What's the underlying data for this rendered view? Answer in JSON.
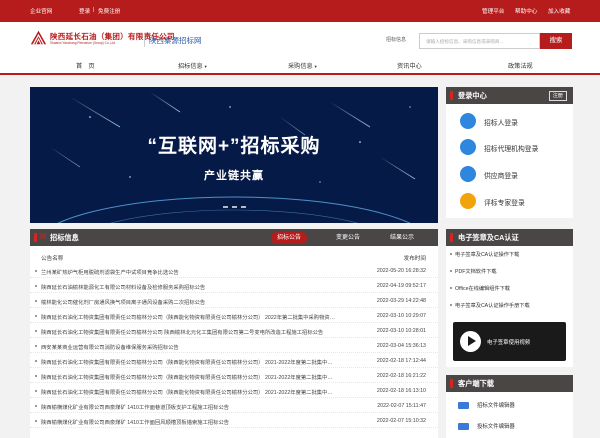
{
  "topbar": {
    "enterprise_site": "企业官网",
    "login": "登录",
    "separator": "|",
    "free_register": "免费注册",
    "admin_platform": "管理平台",
    "help_center": "帮助中心",
    "add_favorite": "加入收藏"
  },
  "header": {
    "company_cn": "陕西延长石油（集团）有限责任公司",
    "company_en": "Shaanxi Yanchang Petroleum (Group) Co.,Ltd.",
    "site_name": "陕西秦源招标网",
    "search_label": "招标信息",
    "search_placeholder": "请输入招标信息、采购信息或采购商...",
    "search_button": "搜索"
  },
  "nav": {
    "items": [
      {
        "label": "首　页",
        "dropdown": false
      },
      {
        "label": "招标信息",
        "dropdown": true
      },
      {
        "label": "采购信息",
        "dropdown": true
      },
      {
        "label": "资讯中心",
        "dropdown": false
      },
      {
        "label": "政策法规",
        "dropdown": false
      }
    ]
  },
  "banner": {
    "title": "“互联网+”招标采购",
    "subtitle": "产业链共赢"
  },
  "login_center": {
    "title": "登录中心",
    "register": "注册",
    "items": [
      {
        "label": "招标人登录",
        "color": "#2e86de"
      },
      {
        "label": "招标代理机构登录",
        "color": "#2e86de"
      },
      {
        "label": "供应商登录",
        "color": "#2e86de"
      },
      {
        "label": "评标专家登录",
        "color": "#f0a30a"
      }
    ]
  },
  "tender_info": {
    "title": "招标信息",
    "tabs": [
      {
        "label": "招标公告",
        "active": true
      },
      {
        "label": "变更公告",
        "active": false
      },
      {
        "label": "结果公示",
        "active": false
      }
    ],
    "col_announcement": "公告名称",
    "col_date": "发布时间",
    "rows": [
      {
        "title": "兰州某矿热炉气柜用脱硫剂滤袋生产中试项目竞争比选公告",
        "date": "2022-05-20 16:28:32"
      },
      {
        "title": "陕西延长石油榆林能源化工有限公司材料设备及检修服务采购招标公告",
        "date": "2022-04-19 09:52:17"
      },
      {
        "title": "榆林能化公司催化剂厂房通风换气项目离子通风设备采购二次招标公告",
        "date": "2022-03-29 14:22:48"
      },
      {
        "title": "陕西延长石油化工物资集团有限责任公司榆林分公司（陕西能化物资有限责任公司榆林分公司） 2022年第二批集中采购物资代储供应商招标公告",
        "date": "2022-03-10 10:29:07"
      },
      {
        "title": "陕西延长石油化工物资集团有限责任公司榆林分公司 陕西榆林北元化工集团有限公司第二号变电所改造工程施工招标公告",
        "date": "2022-03-10 10:28:01"
      },
      {
        "title": "西安某某商业运营有限公司消防设备维保服务采购招标公告",
        "date": "2022-03-04 15:36:13"
      },
      {
        "title": "陕西延长石油化工物资集团有限责任公司榆林分公司（陕西能化物资有限责任公司榆林分公司） 2021-2022年度第二批集中采购物资代储供应商招标公告",
        "date": "2022-02-18 17:12:44"
      },
      {
        "title": "陕西延长石油化工物资集团有限责任公司榆林分公司（陕西能化物资有限责任公司榆林分公司） 2021-2022年度第二批集中采购物资代储供应商招标公告",
        "date": "2022-02-18 16:21:22"
      },
      {
        "title": "陕西延长石油化工物资集团有限责任公司榆林分公司（陕西能化物资有限责任公司榆林分公司） 2021-2022年度第二批集中采购物资代储供应商招标公告",
        "date": "2022-02-18 16:13:10"
      },
      {
        "title": "陕西榆横煤化矿业有限公司西泉煤矿 1410工作面巷道顶板支护工程施工招标公告",
        "date": "2022-02-07 15:11:47"
      },
      {
        "title": "陕西榆横煤化矿业有限公司西泉煤矿 1410工作面回风顺槽顶板锚索施工招标公告",
        "date": "2022-02-07 15:10:32"
      }
    ]
  },
  "esign": {
    "title": "电子签章及CA认证",
    "items": [
      "电子签章及CA认证操作下载",
      "PDF文档软件下载",
      "Office在线编辑组件下载",
      "电子签章及CA认证操作手册下载"
    ],
    "video_label": "电子签章使用视频"
  },
  "client_download": {
    "title": "客户端下载",
    "items": [
      "招标文件编辑器",
      "投标文件编辑器"
    ]
  }
}
